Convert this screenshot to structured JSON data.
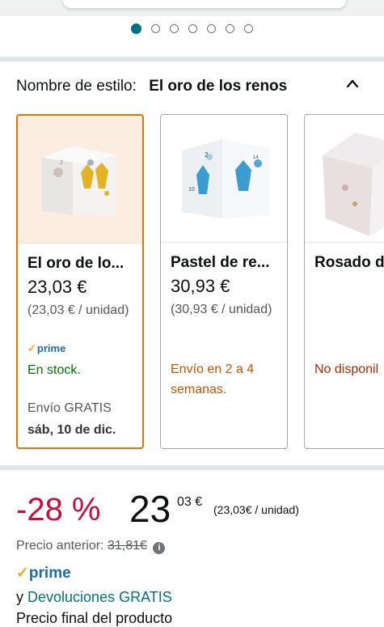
{
  "carousel": {
    "dot_count": 7,
    "active_index": 0
  },
  "style_selector": {
    "label": "Nombre de estilo:",
    "value": "El oro de los renos",
    "collapse_icon": "chevron-up-icon"
  },
  "variants": [
    {
      "name": "El oro de lo...",
      "price": "23,03 €",
      "unit_price": "(23,03 € / unidad)",
      "prime": "prime",
      "availability": "En stock.",
      "availability_color": "#007600",
      "shipping": "Envío GRATIS",
      "delivery_date": "sáb, 10 de dic.",
      "selected": true
    },
    {
      "name": "Pastel de re...",
      "price": "30,93 €",
      "unit_price": "(30,93 € / unidad)",
      "availability": "Envío en 2 a 4 semanas.",
      "availability_color": "#c45500",
      "selected": false
    },
    {
      "name": "Rosado d",
      "availability": "No disponil",
      "availability_color": "#b12704",
      "selected": false
    }
  ],
  "buybox": {
    "discount": "-28 %",
    "price_whole": "23",
    "price_fraction": "03 €",
    "price_per_unit": "(23,03€ / unidad)",
    "previous_label": "Precio anterior:",
    "previous_price": "31,81€",
    "prime": "prime",
    "returns_prefix": "y",
    "returns_link": "Devoluciones GRATIS",
    "final_price_label": "Precio final del producto"
  },
  "colors": {
    "accent": "#007185",
    "selected_border": "#e77600",
    "discount": "#cc0c39",
    "prime_blue": "#1a6ea8"
  }
}
